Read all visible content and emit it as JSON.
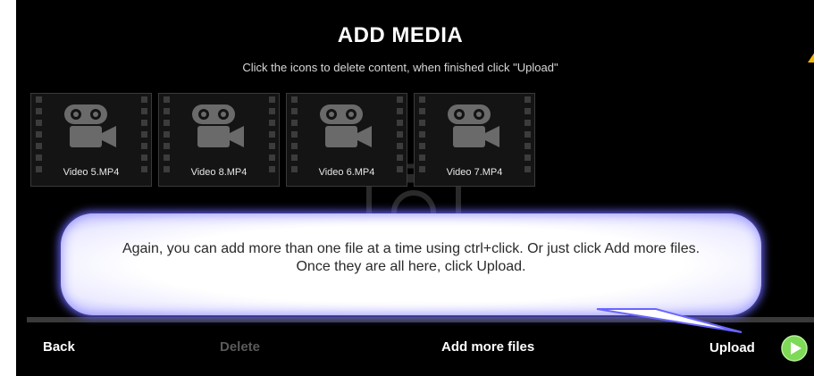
{
  "header": {
    "title": "ADD MEDIA",
    "subtitle": "Click the icons to delete content, when finished click \"Upload\""
  },
  "media_items": [
    {
      "label": "Video 5.MP4",
      "icon": "video-camera-icon"
    },
    {
      "label": "Video 8.MP4",
      "icon": "video-camera-icon"
    },
    {
      "label": "Video 6.MP4",
      "icon": "video-camera-icon"
    },
    {
      "label": "Video 7.MP4",
      "icon": "video-camera-icon"
    }
  ],
  "callout": {
    "text": "Again, you can add more than one file at a time using ctrl+click.  Or just click Add more files.  Once they are all here, click Upload."
  },
  "toolbar": {
    "back_label": "Back",
    "delete_label": "Delete",
    "add_more_label": "Add more files",
    "upload_label": "Upload"
  },
  "colors": {
    "background": "#000000",
    "upload_accent": "#7ed957",
    "callout_glow": "#6a66ff",
    "disabled_text": "#5a5a5a",
    "arrow": "#f5b800"
  }
}
